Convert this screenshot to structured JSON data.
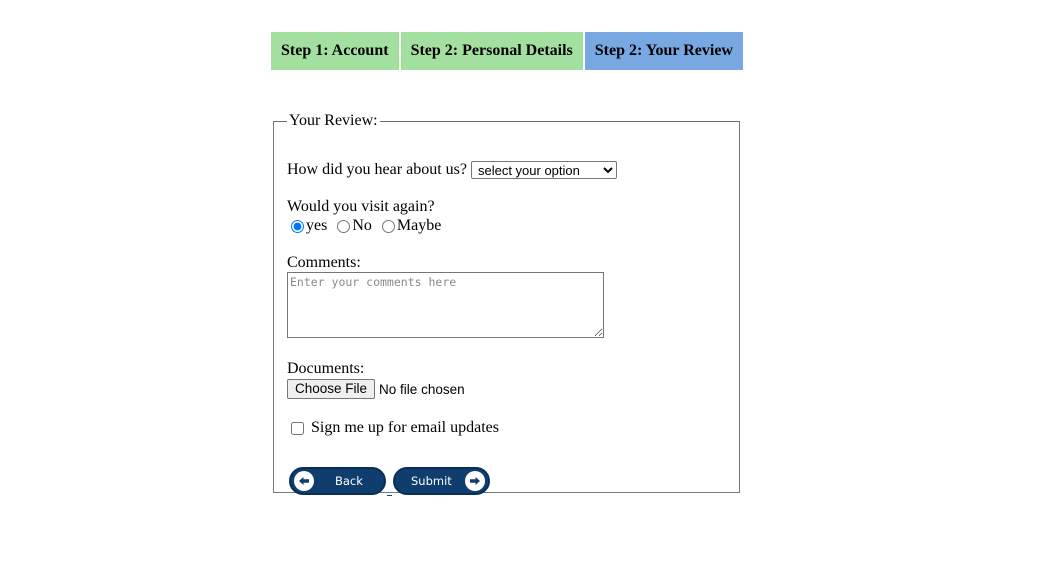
{
  "tabs": [
    {
      "label": "Step 1: Account",
      "state": "done"
    },
    {
      "label": "Step 2: Personal Details",
      "state": "done"
    },
    {
      "label": "Step 2: Your Review",
      "state": "active"
    }
  ],
  "form": {
    "legend": "Your Review:",
    "hear": {
      "label": "How did you hear about us?",
      "selected": "select your option"
    },
    "visit": {
      "label": "Would you visit again?",
      "options": [
        "yes",
        "No",
        "Maybe"
      ],
      "selected": "yes"
    },
    "comments": {
      "label": "Comments:",
      "placeholder": "Enter your comments here"
    },
    "documents": {
      "label": "Documents:",
      "button_label": "Choose File",
      "status": "No file chosen"
    },
    "email_updates": {
      "label": "Sign me up for email updates",
      "checked": false
    },
    "buttons": {
      "back_label": "Back",
      "submit_label": "Submit"
    }
  },
  "colors": {
    "tab_done": "#a3df9f",
    "tab_active": "#78a8e1",
    "button_bg": "#0f3e6e"
  }
}
